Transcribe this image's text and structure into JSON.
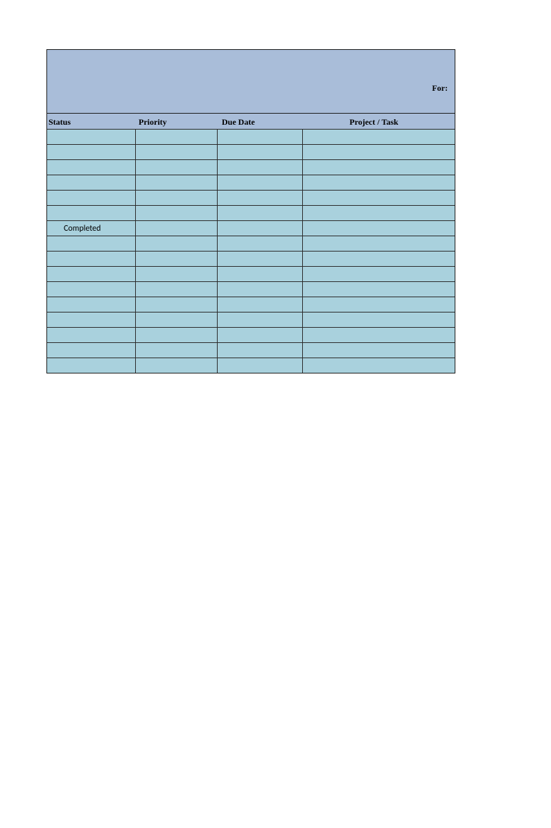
{
  "header": {
    "for_label": "For:"
  },
  "columns": {
    "status": "Status",
    "priority": "Priority",
    "due_date": "Due Date",
    "project_task": "Project / Task"
  },
  "rows": [
    {
      "status": "",
      "priority": "",
      "due_date": "",
      "project_task": ""
    },
    {
      "status": "",
      "priority": "",
      "due_date": "",
      "project_task": ""
    },
    {
      "status": "",
      "priority": "",
      "due_date": "",
      "project_task": ""
    },
    {
      "status": "",
      "priority": "",
      "due_date": "",
      "project_task": ""
    },
    {
      "status": "",
      "priority": "",
      "due_date": "",
      "project_task": ""
    },
    {
      "status": "",
      "priority": "",
      "due_date": "",
      "project_task": ""
    },
    {
      "status": "Completed",
      "priority": "",
      "due_date": "",
      "project_task": ""
    },
    {
      "status": "",
      "priority": "",
      "due_date": "",
      "project_task": ""
    },
    {
      "status": "",
      "priority": "",
      "due_date": "",
      "project_task": ""
    },
    {
      "status": "",
      "priority": "",
      "due_date": "",
      "project_task": ""
    },
    {
      "status": "",
      "priority": "",
      "due_date": "",
      "project_task": ""
    },
    {
      "status": "",
      "priority": "",
      "due_date": "",
      "project_task": ""
    },
    {
      "status": "",
      "priority": "",
      "due_date": "",
      "project_task": ""
    },
    {
      "status": "",
      "priority": "",
      "due_date": "",
      "project_task": ""
    },
    {
      "status": "",
      "priority": "",
      "due_date": "",
      "project_task": ""
    },
    {
      "status": "",
      "priority": "",
      "due_date": "",
      "project_task": ""
    }
  ]
}
